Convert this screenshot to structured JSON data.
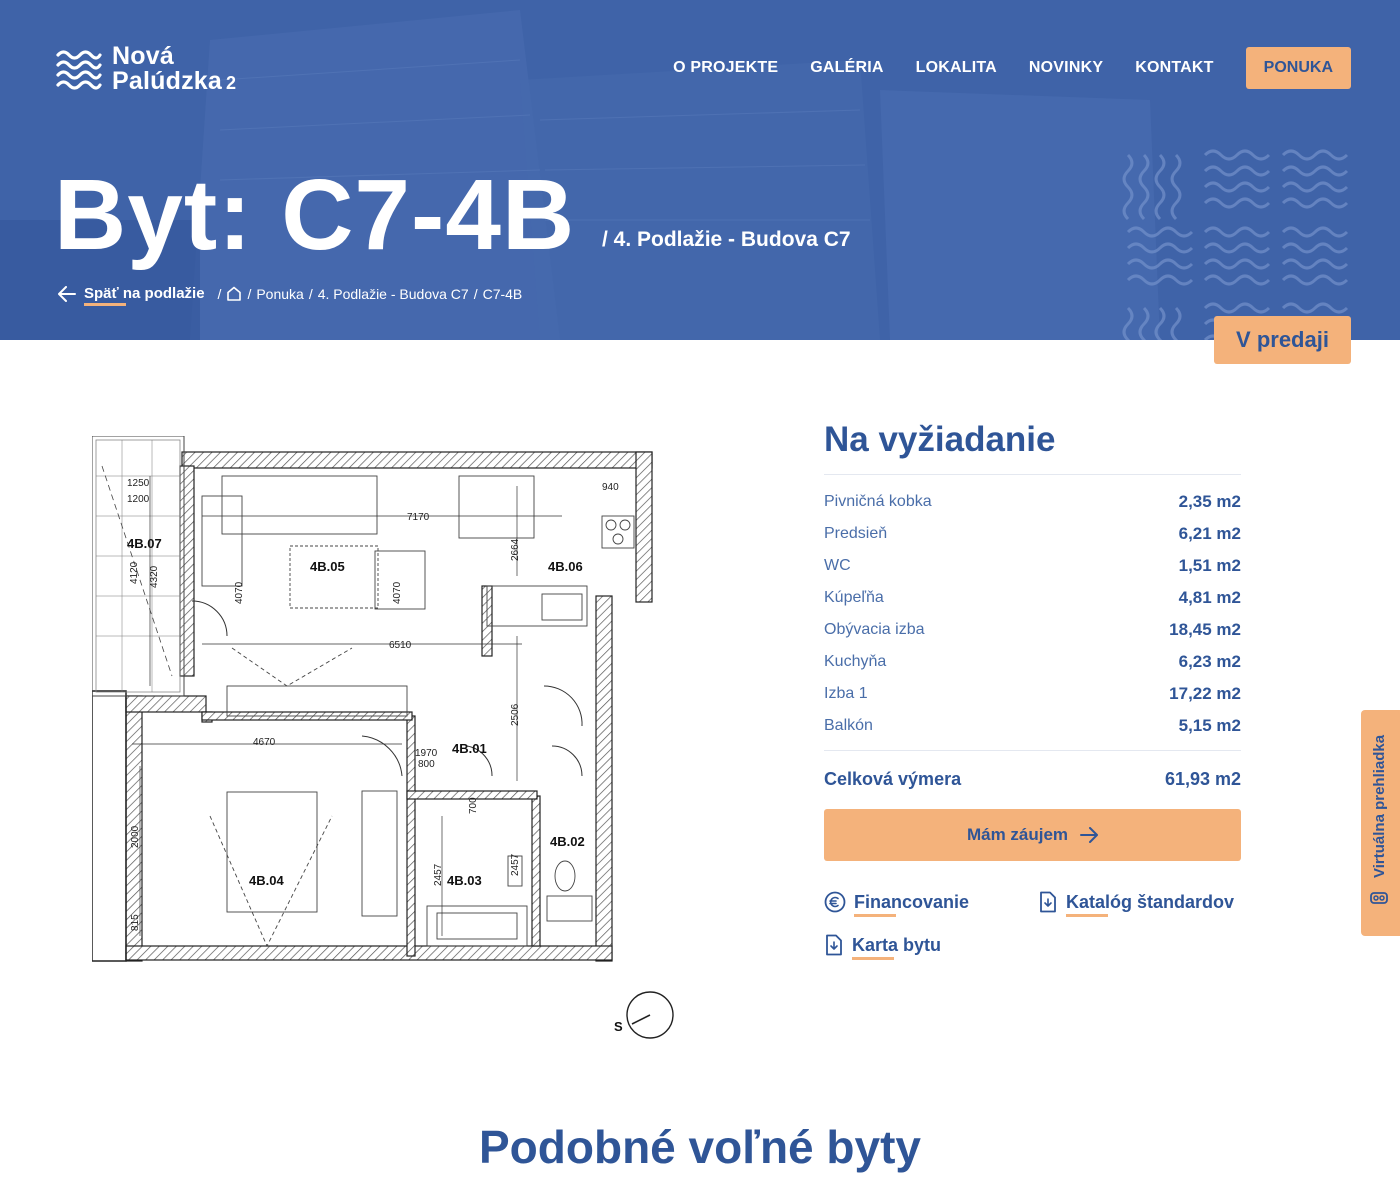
{
  "logo": {
    "line1": "Nová",
    "line2": "Palúdzka",
    "number": "2"
  },
  "nav": {
    "items": [
      "O PROJEKTE",
      "GALÉRIA",
      "LOKALITA",
      "NOVINKY",
      "KONTAKT"
    ],
    "cta": "PONUKA"
  },
  "hero": {
    "title": "Byt: C7-4B",
    "subtitle": "/ 4. Podlažie - Budova C7"
  },
  "breadcrumb": {
    "back": "Späť na podlažie",
    "items": [
      "Ponuka",
      "4. Podlažie - Budova C7",
      "C7-4B"
    ]
  },
  "status_badge": "V predaji",
  "plan": {
    "rooms": [
      "4B.07",
      "4B.05",
      "4B.06",
      "4B.01",
      "4B.04",
      "4B.03",
      "4B.02"
    ],
    "dims": [
      "1250",
      "1200",
      "7170",
      "4120",
      "4320",
      "4070",
      "4070",
      "2664",
      "6510",
      "2506",
      "4670",
      "2000",
      "2457",
      "2457",
      "815",
      "940",
      "1970",
      "800",
      "700"
    ],
    "compass": "S"
  },
  "info": {
    "price": "Na vyžiadanie",
    "rooms": [
      {
        "name": "Pivničná kobka",
        "area": "2,35 m2"
      },
      {
        "name": "Predsieň",
        "area": "6,21 m2"
      },
      {
        "name": "WC",
        "area": "1,51 m2"
      },
      {
        "name": "Kúpeľňa",
        "area": "4,81 m2"
      },
      {
        "name": "Obývacia izba",
        "area": "18,45 m2"
      },
      {
        "name": "Kuchyňa",
        "area": "6,23 m2"
      },
      {
        "name": "Izba 1",
        "area": "17,22 m2"
      },
      {
        "name": "Balkón",
        "area": "5,15 m2"
      }
    ],
    "total_label": "Celková výmera",
    "total_value": "61,93 m2",
    "interest_button": "Mám záujem",
    "links": {
      "financing": "Financovanie",
      "catalog": "Katalóg štandardov",
      "card": "Karta bytu"
    }
  },
  "side_tab": "Virtuálna prehliadka",
  "similar_title": "Podobné voľné byty",
  "colors": {
    "primary": "#2f5597",
    "hero_bg": "#3f63a8",
    "accent": "#f4b27b"
  }
}
